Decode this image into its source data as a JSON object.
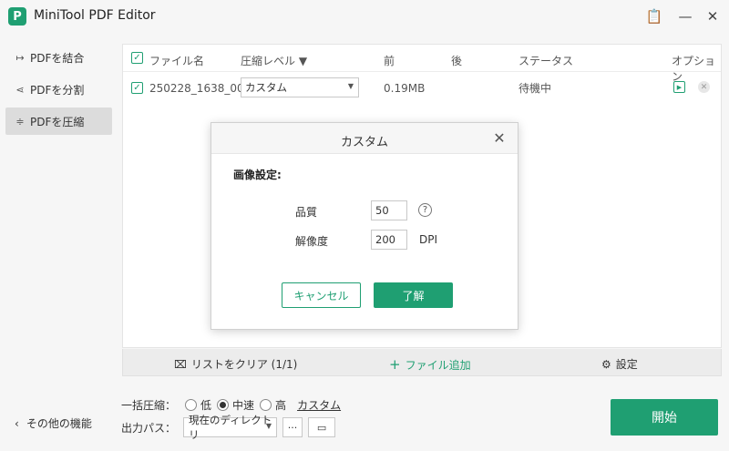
{
  "app": {
    "title": "MiniTool PDF Editor",
    "logo_letter": "P"
  },
  "titlebar": {
    "feedback_icon": "📋",
    "minimize": "—",
    "close": "✕"
  },
  "sidebar": {
    "items": [
      {
        "label": "PDFを結合",
        "icon": "↦"
      },
      {
        "label": "PDFを分割",
        "icon": "⋖"
      },
      {
        "label": "PDFを圧縮",
        "icon": "≑"
      }
    ],
    "other": {
      "label": "その他の機能",
      "icon": "‹"
    }
  },
  "table": {
    "headers": {
      "filename": "ファイル名",
      "level": "圧縮レベル ▼",
      "before": "前",
      "after": "後",
      "status": "ステータス",
      "option": "オプション"
    },
    "rows": [
      {
        "filename": "250228_1638_001...",
        "level": "カスタム",
        "before": "0.19MB",
        "after": "",
        "status": "待機中"
      }
    ]
  },
  "bottom_bar": {
    "clear": "リストをクリア (1/1)",
    "add": "ファイル追加",
    "settings": "設定"
  },
  "options": {
    "bulk_label": "一括圧縮：",
    "radios": [
      "低",
      "中速",
      "高"
    ],
    "custom": "カスタム",
    "path_label": "出力パス：",
    "path_value": "現在のディレクトリ",
    "more": "···"
  },
  "start_button": "開始",
  "dialog": {
    "title": "カスタム",
    "section": "画像設定:",
    "quality_label": "品質",
    "quality_value": "50",
    "resolution_label": "解像度",
    "resolution_value": "200",
    "resolution_unit": "DPI",
    "cancel": "キャンセル",
    "ok": "了解"
  },
  "colors": {
    "accent": "#1f9f72"
  }
}
